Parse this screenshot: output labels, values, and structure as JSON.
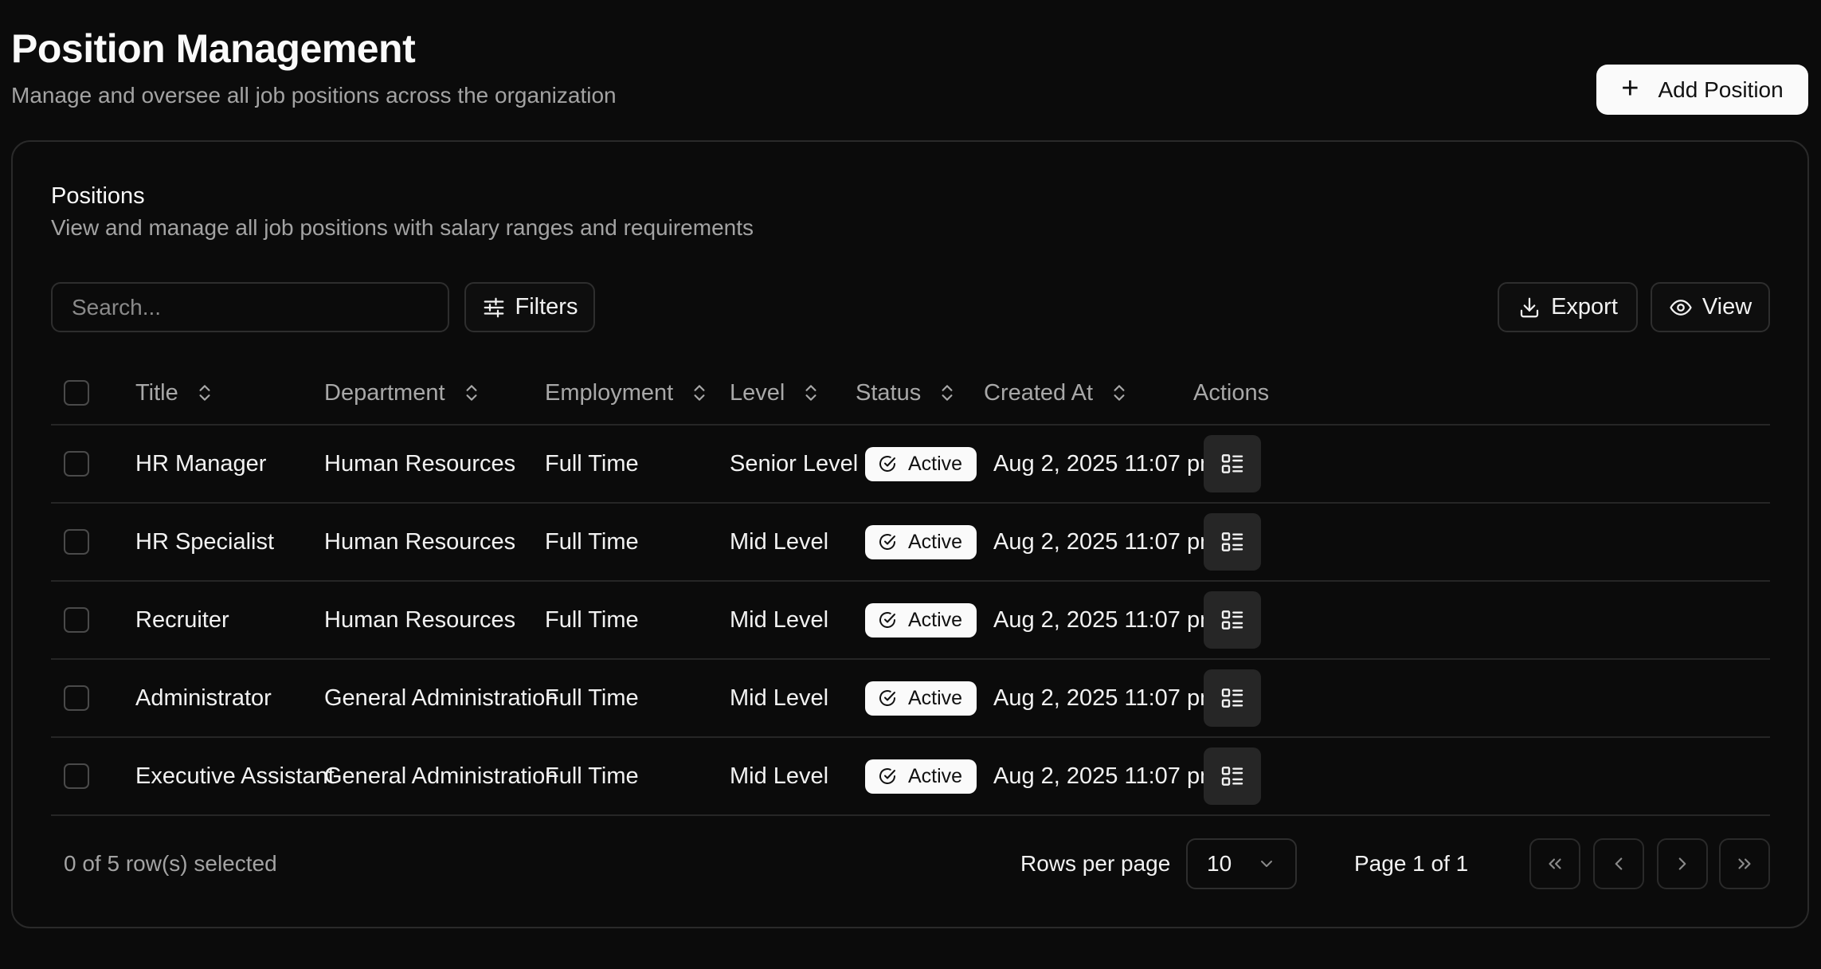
{
  "header": {
    "title": "Position Management",
    "subtitle": "Manage and oversee all job positions across the organization",
    "add_button_label": "Add Position"
  },
  "card": {
    "title": "Positions",
    "description": "View and manage all job positions with salary ranges and requirements"
  },
  "toolbar": {
    "search_placeholder": "Search...",
    "filters_label": "Filters",
    "export_label": "Export",
    "view_label": "View"
  },
  "table": {
    "columns": {
      "title": "Title",
      "department": "Department",
      "employment": "Employment",
      "level": "Level",
      "status": "Status",
      "created_at": "Created At",
      "actions": "Actions"
    },
    "rows": [
      {
        "title": "HR Manager",
        "department": "Human Resources",
        "employment": "Full Time",
        "level": "Senior Level",
        "status": "Active",
        "created_at": "Aug 2, 2025 11:07 pm"
      },
      {
        "title": "HR Specialist",
        "department": "Human Resources",
        "employment": "Full Time",
        "level": "Mid Level",
        "status": "Active",
        "created_at": "Aug 2, 2025 11:07 pm"
      },
      {
        "title": "Recruiter",
        "department": "Human Resources",
        "employment": "Full Time",
        "level": "Mid Level",
        "status": "Active",
        "created_at": "Aug 2, 2025 11:07 pm"
      },
      {
        "title": "Administrator",
        "department": "General Administration",
        "employment": "Full Time",
        "level": "Mid Level",
        "status": "Active",
        "created_at": "Aug 2, 2025 11:07 pm"
      },
      {
        "title": "Executive Assistant",
        "department": "General Administration",
        "employment": "Full Time",
        "level": "Mid Level",
        "status": "Active",
        "created_at": "Aug 2, 2025 11:07 pm"
      }
    ]
  },
  "footer": {
    "selected_text": "0 of 5 row(s) selected",
    "rows_per_page_label": "Rows per page",
    "rows_per_page_value": "10",
    "page_info": "Page 1 of 1"
  },
  "icons": {
    "add": "plus-icon",
    "filters": "sliders-icon",
    "export": "download-icon",
    "view": "eye-icon",
    "sort": "chevrons-up-down-icon",
    "status": "check-circle-icon",
    "row_action": "list-details-icon",
    "select": "chevron-down-icon",
    "first_page": "chevrons-left-icon",
    "prev_page": "chevron-left-icon",
    "next_page": "chevron-right-icon",
    "last_page": "chevrons-right-icon"
  },
  "colors": {
    "background": "#0b0b0b",
    "primary_button": "#fafafa",
    "muted_text": "#a3a3a3",
    "border": "#2a2a2a",
    "badge_bg": "#fafafa"
  }
}
